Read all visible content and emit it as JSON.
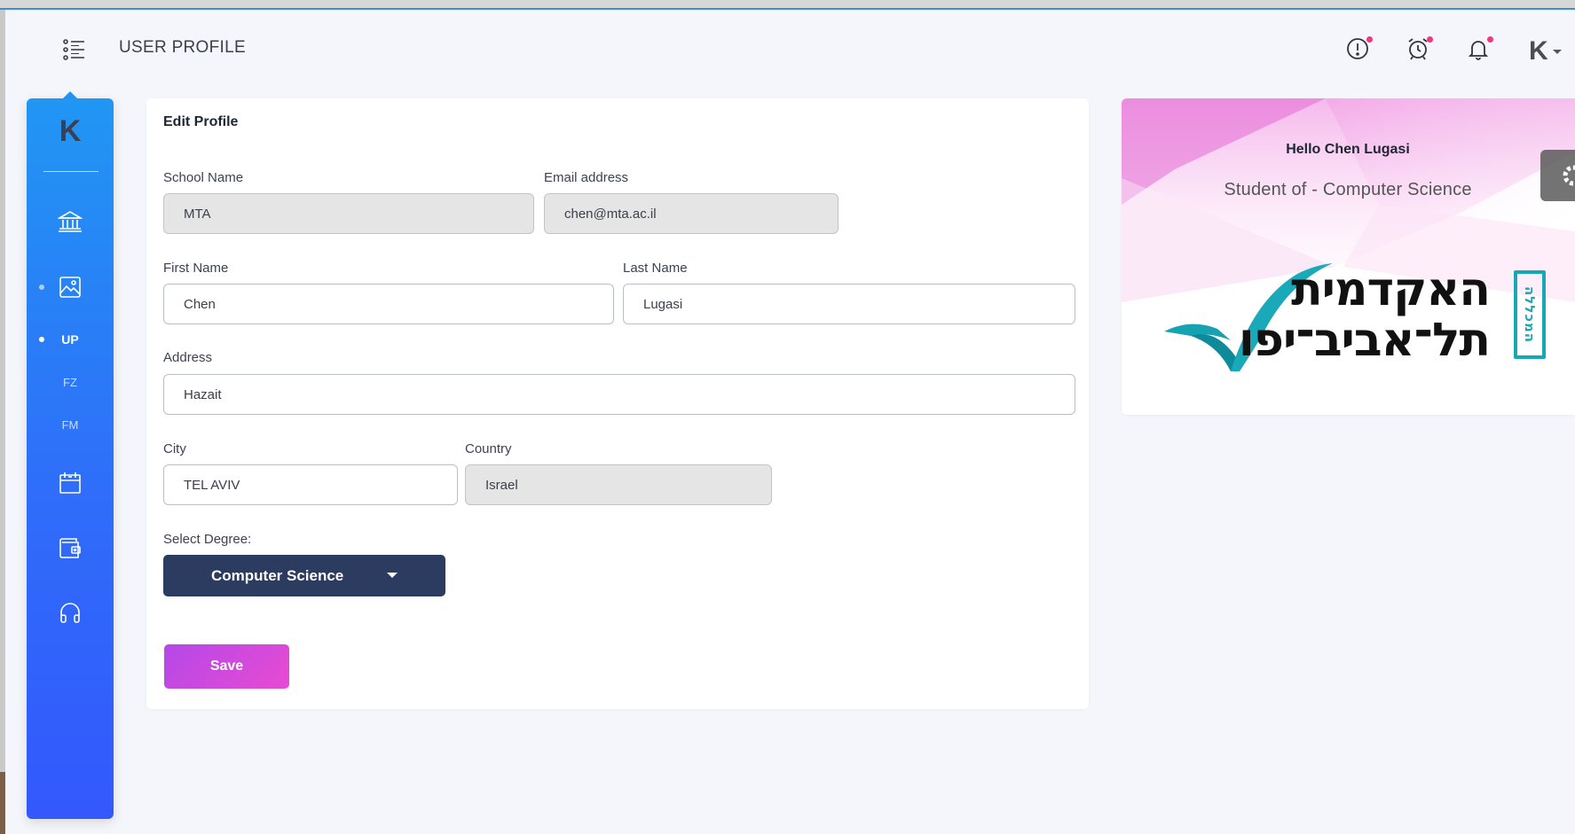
{
  "header": {
    "title": "USER PROFILE",
    "user_initial": "K"
  },
  "sidebar": {
    "logo": "K",
    "items": [
      {
        "icon": "bank-icon"
      },
      {
        "icon": "image-icon",
        "active_dot": true
      },
      {
        "label": "UP",
        "active_dot": true
      },
      {
        "label": "FZ"
      },
      {
        "label": "FM"
      },
      {
        "icon": "calendar-icon"
      },
      {
        "icon": "wallet-icon"
      },
      {
        "icon": "headphones-icon"
      }
    ]
  },
  "edit_profile": {
    "title": "Edit Profile",
    "fields": {
      "school_name": {
        "label": "School Name",
        "value": "MTA"
      },
      "email": {
        "label": "Email address",
        "value": "chen@mta.ac.il"
      },
      "first_name": {
        "label": "First Name",
        "value": "Chen"
      },
      "last_name": {
        "label": "Last Name",
        "value": "Lugasi"
      },
      "address": {
        "label": "Address",
        "value": "Hazait"
      },
      "city": {
        "label": "City",
        "value": "TEL AVIV"
      },
      "country": {
        "label": "Country",
        "value": "Israel"
      }
    },
    "degree": {
      "label": "Select Degree:",
      "selected": "Computer Science"
    },
    "save_label": "Save"
  },
  "profile_card": {
    "greeting": "Hello Chen Lugasi",
    "subtitle": "Student of - Computer Science",
    "logo_line1": "האקדמית",
    "logo_line2": "תל־אביב־יפו",
    "logo_vertical": "המכללה"
  },
  "colors": {
    "sidebar_top": "#2196f3",
    "sidebar_bottom": "#3358fc",
    "degree_button": "#2c3b60",
    "save_gradient_start": "#b548e8",
    "save_gradient_end": "#e84bd1",
    "notification_dot": "#f5367a",
    "logo_teal": "#18a7b5"
  }
}
